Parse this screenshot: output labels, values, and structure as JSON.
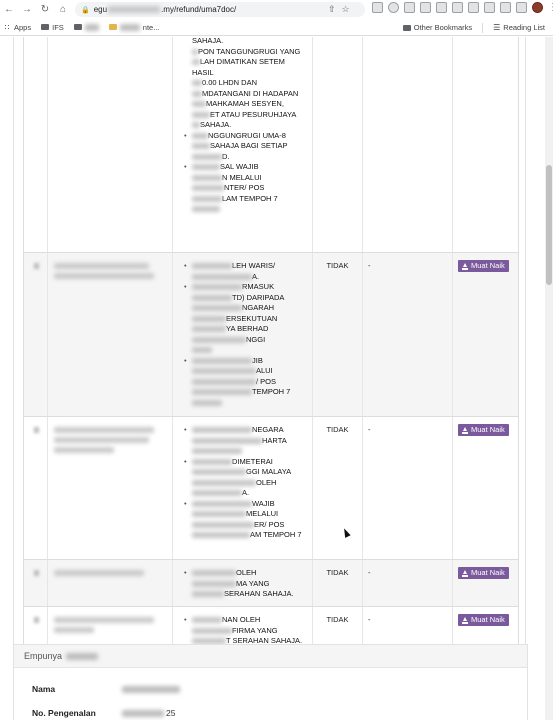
{
  "browser": {
    "url_prefix": "egu",
    "url_suffix": ".my/refund/uma7doc/",
    "bookmarks": [
      {
        "label": "Apps",
        "icon": "apps-grid-icon"
      },
      {
        "label": "IFS",
        "icon": "folder-icon"
      }
    ],
    "bookmark_partial": "nte...",
    "other_bookmarks": "Other Bookmarks",
    "reading_list": "Reading List"
  },
  "table": {
    "rows": [
      {
        "cont_lines": [
          "SAHAJA.",
          "PON TANGGUNGRUGI YANG",
          "LAH DIMATIKAN SETEM HASIL",
          "0.00 LHDN DAN",
          "MDATANGANI DI HADAPAN",
          "MAHKAMAH SESYEN,",
          "ET ATAU PESURUHJAYA",
          "SAHAJA."
        ],
        "items": [
          [
            "NGGUNGRUGI UMA-8",
            "SAHAJA BAGI SETIAP",
            "D."
          ],
          [
            "SAL WAJIB",
            "N MELALUI",
            "NTER/ POS",
            "LAM TEMPOH 7"
          ]
        ]
      },
      {
        "items": [
          [
            "LEH WARIS/",
            "A."
          ],
          [
            "RMASUK",
            "TD) DARIPADA",
            "NGARAH",
            "ERSEKUTUAN",
            "YA BERHAD",
            "NGGI"
          ],
          [
            "JIB",
            "ALUI",
            "/ POS",
            "TEMPOH 7"
          ]
        ],
        "status": "TIDAK",
        "remark": "-",
        "button": "Muat Naik"
      },
      {
        "items": [
          [
            "NEGARA",
            "HARTA"
          ],
          [
            "DIMETERAI",
            "GGI MALAYA",
            "OLEH",
            "A."
          ],
          [
            "WAJIB",
            "MELALUI",
            "ER/ POS",
            "AM TEMPOH 7"
          ]
        ],
        "status": "TIDAK",
        "remark": "-",
        "button": "Muat Naik"
      },
      {
        "items": [
          [
            "OLEH",
            "MA YANG",
            "SERAHAN SAHAJA."
          ]
        ],
        "status": "TIDAK",
        "remark": "-",
        "button": "Muat Naik"
      },
      {
        "items": [
          [
            "NAN OLEH",
            "FIRMA YANG",
            "T SERAHAN SAHAJA."
          ]
        ],
        "status": "TIDAK",
        "remark": "-",
        "button": "Muat Naik"
      }
    ]
  },
  "owner": {
    "heading": "Empunya",
    "name_label": "Nama",
    "id_label": "No. Pengenalan",
    "id_value_visible": "25"
  }
}
